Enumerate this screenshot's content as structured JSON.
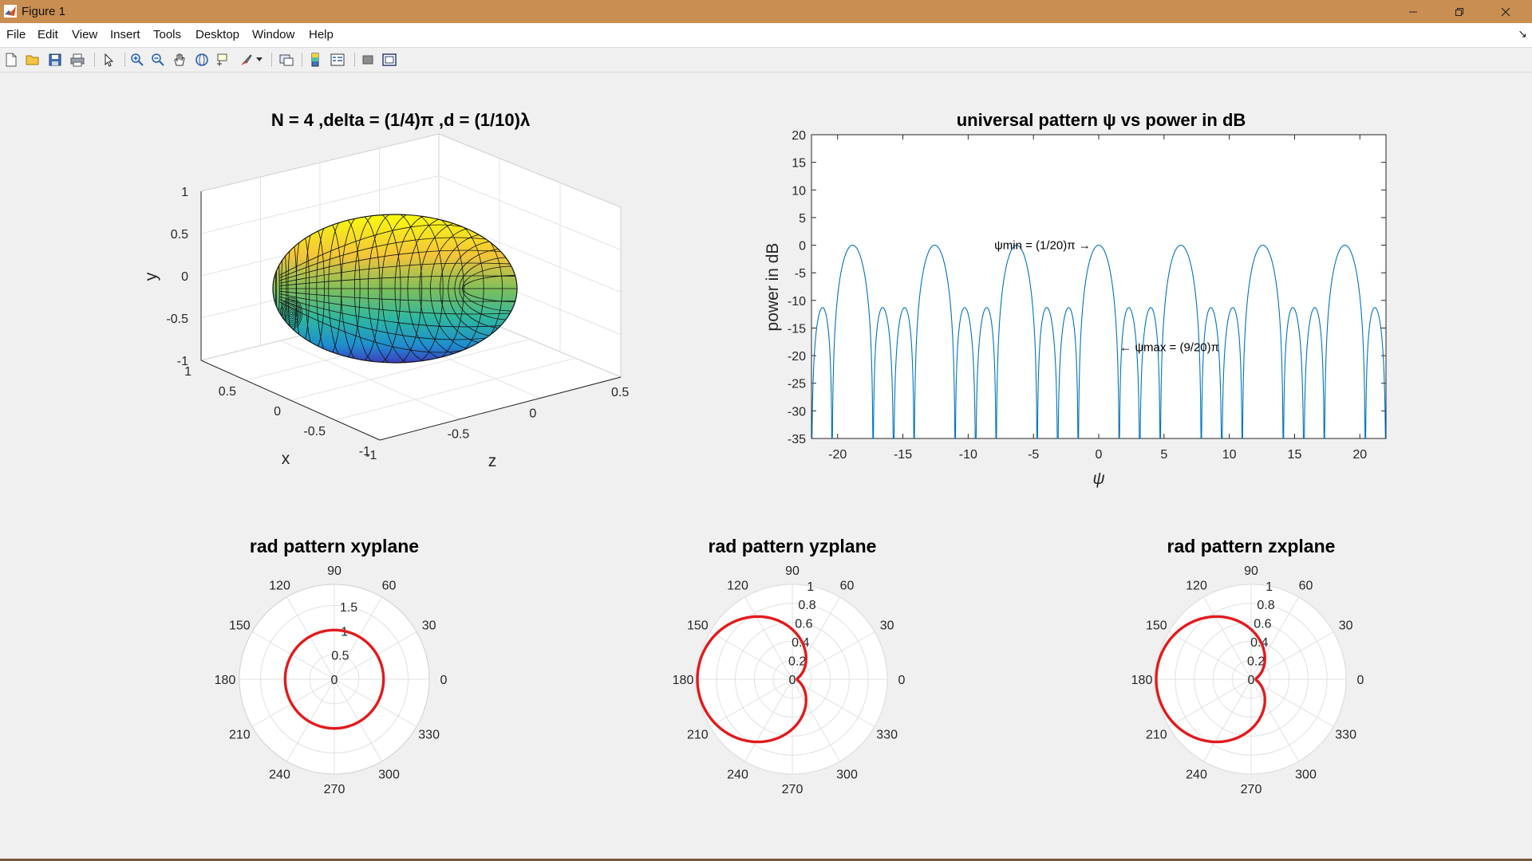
{
  "window": {
    "title": "Figure 1",
    "accent": "#c98e52",
    "controls": [
      "minimize-icon",
      "restore-icon",
      "close-icon"
    ]
  },
  "menu": [
    "File",
    "Edit",
    "View",
    "Insert",
    "Tools",
    "Desktop",
    "Window",
    "Help"
  ],
  "toolbar": [
    "new-figure-icon",
    "open-file-icon",
    "save-icon",
    "print-icon",
    "edit-plot-arrow-icon",
    "zoom-in-icon",
    "zoom-out-icon",
    "pan-hand-icon",
    "rotate-3d-icon",
    "data-cursor-icon",
    "brush-icon",
    "brush-dropdown-icon",
    "link-plot-icon",
    "colorbar-icon",
    "legend-icon",
    "hide-plot-tools-icon",
    "show-plot-tools-icon"
  ],
  "chart_data": [
    {
      "type": "surface",
      "title": "N = 4 ,delta = (1/4)π ,d = (1/10)λ",
      "xlabel": "x",
      "ylabel": "y",
      "zlabel": "z",
      "xticks": [
        "1",
        "0.5",
        "0",
        "-0.5",
        "-1"
      ],
      "yticks": [
        "1",
        "0.5",
        "0",
        "-0.5",
        "-1"
      ],
      "zticks": [
        "-1",
        "-0.5",
        "0",
        "0.5"
      ],
      "colormap": "parula",
      "grid": true
    },
    {
      "type": "line",
      "title": "universal pattern ψ vs power in dB",
      "xlabel": "ψ",
      "ylabel": "power in dB",
      "xlim": [
        -22,
        22
      ],
      "ylim": [
        -35,
        20
      ],
      "xticks": [
        "-20",
        "-15",
        "-10",
        "-5",
        "0",
        "5",
        "10",
        "15",
        "20"
      ],
      "yticks": [
        "20",
        "15",
        "10",
        "5",
        "0",
        "-5",
        "-10",
        "-15",
        "-20",
        "-25",
        "-30",
        "-35"
      ],
      "series": [
        {
          "color": "#0072bd",
          "function": "20*log10(|sin(2ψ)/(4 sin(ψ/2))|)",
          "x": [
            -22,
            22
          ]
        }
      ],
      "annotations": [
        {
          "text": "ψmin = (1/20)π →",
          "x": -8,
          "y": 0
        },
        {
          "text": "← ψmax = (9/20)π",
          "x": 1.6,
          "y": -18.5
        }
      ]
    },
    {
      "type": "polar",
      "title": "rad pattern xyplane",
      "angle_labels": [
        "0",
        "30",
        "60",
        "90",
        "120",
        "150",
        "180",
        "210",
        "240",
        "270",
        "300",
        "330"
      ],
      "r_max": 1.93,
      "r_labels": [
        "0",
        "0.5",
        "1",
        "1.5"
      ],
      "series": [
        {
          "color": "#e31a1c",
          "r_constant": 1
        }
      ]
    },
    {
      "type": "polar",
      "title": "rad pattern yzplane",
      "angle_labels": [
        "0",
        "30",
        "60",
        "90",
        "120",
        "150",
        "180",
        "210",
        "240",
        "270",
        "300",
        "330"
      ],
      "r_max": 1,
      "r_labels": [
        "0",
        "0.2",
        "0.4",
        "0.6",
        "0.8",
        "1"
      ],
      "series": [
        {
          "color": "#e31a1c",
          "curve": "cardioid",
          "r_min": 0.05,
          "r_max": 1,
          "direction_deg": 180
        }
      ]
    },
    {
      "type": "polar",
      "title": "rad pattern zxplane",
      "angle_labels": [
        "0",
        "30",
        "60",
        "90",
        "120",
        "150",
        "180",
        "210",
        "240",
        "270",
        "300",
        "330"
      ],
      "r_max": 1,
      "r_labels": [
        "0",
        "0.2",
        "0.4",
        "0.6",
        "0.8",
        "1"
      ],
      "series": [
        {
          "color": "#e31a1c",
          "curve": "cardioid",
          "r_min": 0.05,
          "r_max": 1,
          "direction_deg": 180
        }
      ]
    }
  ]
}
